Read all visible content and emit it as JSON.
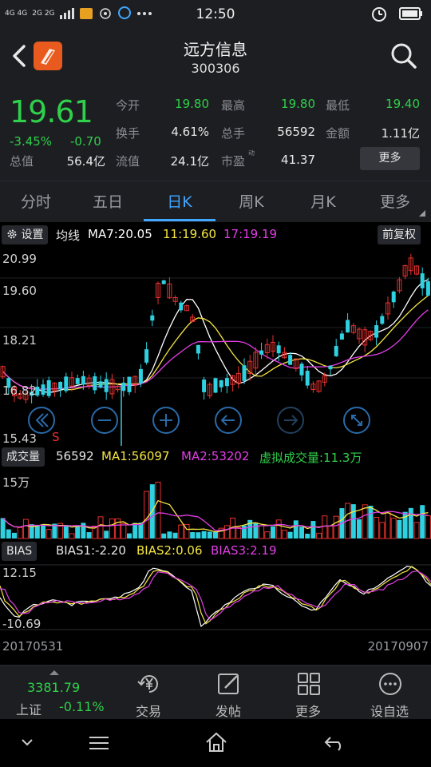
{
  "status_bar": {
    "network": "4G 4G",
    "network2": "2G 2G",
    "time": "12:50"
  },
  "header": {
    "title": "远方信息",
    "code": "300306"
  },
  "quote": {
    "price": "19.61",
    "change_pct": "-3.45%",
    "change": "-0.70",
    "fields": {
      "open_label": "今开",
      "open": "19.80",
      "high_label": "最高",
      "high": "19.80",
      "low_label": "最低",
      "low": "19.40",
      "turnover_label": "换手",
      "turnover": "4.61%",
      "volume_label": "总手",
      "volume": "56592",
      "amount_label": "金额",
      "amount": "1.11亿",
      "mktcap_label": "总值",
      "mktcap": "56.4亿",
      "float_label": "流值",
      "float": "24.1亿",
      "pe_label": "市盈",
      "pe_sup": "动",
      "pe": "41.37"
    },
    "more_label": "更多"
  },
  "tabs": [
    {
      "label": "分时"
    },
    {
      "label": "五日"
    },
    {
      "label": "日K"
    },
    {
      "label": "周K"
    },
    {
      "label": "月K"
    },
    {
      "label": "更多"
    }
  ],
  "active_tab": 2,
  "main_chart": {
    "settings_label": "设置",
    "ma_label": "均线",
    "ma7": "MA7:20.05",
    "ma11": "11:19.60",
    "ma17": "17:19.19",
    "adjust_label": "前复权",
    "y_ticks": [
      "20.99",
      "19.60",
      "18.21",
      "16.82",
      "15.43"
    ],
    "marker": "S"
  },
  "volume_chart": {
    "label": "成交量",
    "vol": "56592",
    "ma1": "MA1:56097",
    "ma2": "MA2:53202",
    "virtual": "虚拟成交量:11.3万",
    "y_tick": "15万"
  },
  "bias_chart": {
    "label": "BIAS",
    "bias1": "BIAS1:-2.20",
    "bias2": "BIAS2:0.06",
    "bias3": "BIAS3:2.19",
    "y_top": "12.15",
    "y_bottom": "-10.69"
  },
  "dates": {
    "start": "20170531",
    "end": "20170907"
  },
  "bottom_bar": {
    "index_value": "3381.79",
    "index_name": "上证",
    "index_change": "-0.11%",
    "buttons": [
      {
        "label": "交易",
        "icon": "yen-icon"
      },
      {
        "label": "发帖",
        "icon": "edit-icon"
      },
      {
        "label": "更多",
        "icon": "grid-icon"
      },
      {
        "label": "设自选",
        "icon": "ellipsis-icon"
      }
    ]
  },
  "colors": {
    "up": "#e8322e",
    "down": "#2fd0e0",
    "green": "#2fd04a",
    "ma7": "#ffffff",
    "ma11": "#f5e642",
    "ma17": "#e23ee6",
    "accent": "#3fa7ff"
  }
}
